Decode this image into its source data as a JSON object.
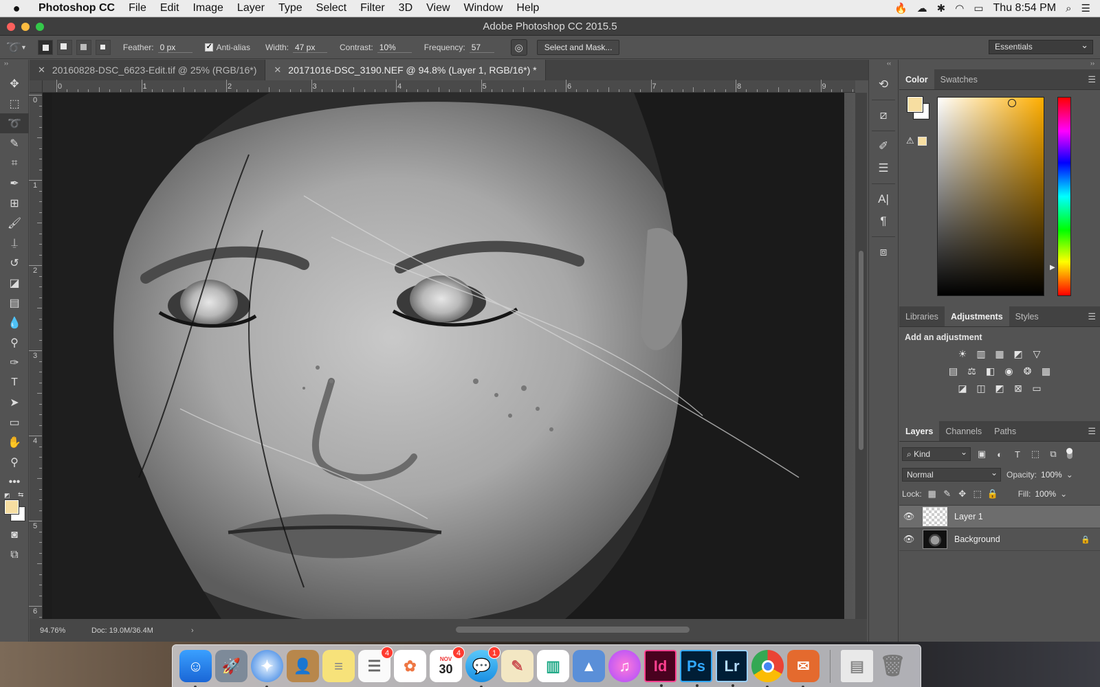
{
  "menubar": {
    "app_name": "Photoshop CC",
    "items": [
      "File",
      "Edit",
      "Image",
      "Layer",
      "Type",
      "Select",
      "Filter",
      "3D",
      "View",
      "Window",
      "Help"
    ],
    "clock": "Thu 8:54 PM"
  },
  "window": {
    "title": "Adobe Photoshop CC 2015.5"
  },
  "options_bar": {
    "feather_label": "Feather:",
    "feather_value": "0 px",
    "antialias_label": "Anti-alias",
    "width_label": "Width:",
    "width_value": "47 px",
    "contrast_label": "Contrast:",
    "contrast_value": "10%",
    "frequency_label": "Frequency:",
    "frequency_value": "57",
    "select_mask_label": "Select and Mask...",
    "workspace": "Essentials"
  },
  "document_tabs": [
    {
      "label": "20160828-DSC_6623-Edit.tif @ 25% (RGB/16*)",
      "active": false
    },
    {
      "label": "20171016-DSC_3190.NEF @ 94.8% (Layer 1, RGB/16*) *",
      "active": true
    }
  ],
  "rulers": {
    "horizontal": [
      "0",
      "1",
      "2",
      "3",
      "4",
      "5",
      "6",
      "7",
      "8",
      "9"
    ],
    "vertical": [
      "0",
      "1",
      "2",
      "3",
      "4",
      "5",
      "6"
    ]
  },
  "status": {
    "zoom": "94.76%",
    "doc_size": "Doc: 19.0M/36.4M"
  },
  "colors": {
    "foreground": "#f7dea1",
    "background": "#ffffff"
  },
  "color_panel": {
    "tabs": [
      "Color",
      "Swatches"
    ]
  },
  "adjustments_panel": {
    "tabs": [
      "Libraries",
      "Adjustments",
      "Styles"
    ],
    "title": "Add an adjustment"
  },
  "layers_panel": {
    "tabs": [
      "Layers",
      "Channels",
      "Paths"
    ],
    "kind_label": "Kind",
    "blend_mode": "Normal",
    "opacity_label": "Opacity:",
    "opacity_value": "100%",
    "lock_label": "Lock:",
    "fill_label": "Fill:",
    "fill_value": "100%",
    "layers": [
      {
        "name": "Layer 1",
        "selected": true
      },
      {
        "name": "Background",
        "selected": false
      }
    ]
  },
  "dock": {
    "badges": {
      "reminders": "4",
      "calendar": "4",
      "messages": "1"
    },
    "calendar_month": "NOV",
    "calendar_day": "30",
    "indesign_label": "Id",
    "photoshop_label": "Ps",
    "lightroom_label": "Lr"
  }
}
